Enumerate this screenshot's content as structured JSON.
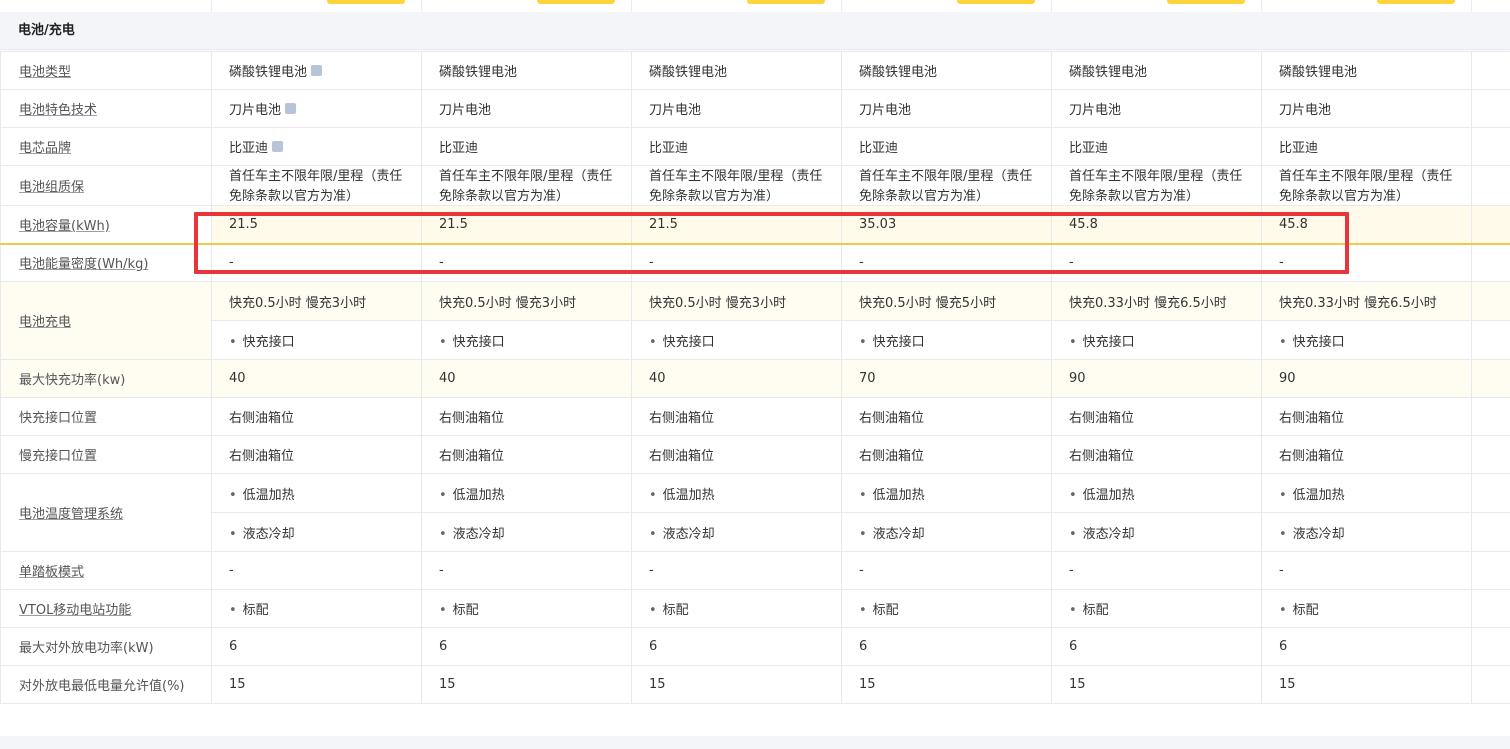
{
  "section_title": "电池/充电",
  "rows": {
    "battery_type": {
      "label": "电池类型",
      "values": [
        "磷酸铁锂电池",
        "磷酸铁锂电池",
        "磷酸铁锂电池",
        "磷酸铁锂电池",
        "磷酸铁锂电池",
        "磷酸铁锂电池"
      ]
    },
    "battery_tech": {
      "label": "电池特色技术",
      "values": [
        "刀片电池",
        "刀片电池",
        "刀片电池",
        "刀片电池",
        "刀片电池",
        "刀片电池"
      ]
    },
    "cell_brand": {
      "label": "电芯品牌",
      "values": [
        "比亚迪",
        "比亚迪",
        "比亚迪",
        "比亚迪",
        "比亚迪",
        "比亚迪"
      ]
    },
    "warranty": {
      "label": "电池组质保",
      "values": [
        "首任车主不限年限/里程（责任免除条款以官方为准）",
        "首任车主不限年限/里程（责任免除条款以官方为准）",
        "首任车主不限年限/里程（责任免除条款以官方为准）",
        "首任车主不限年限/里程（责任免除条款以官方为准）",
        "首任车主不限年限/里程（责任免除条款以官方为准）",
        "首任车主不限年限/里程（责任免除条款以官方为准）"
      ]
    },
    "capacity": {
      "label": "电池容量(kWh)",
      "values": [
        "21.5",
        "21.5",
        "21.5",
        "35.03",
        "45.8",
        "45.8"
      ]
    },
    "energy_density": {
      "label": "电池能量密度(Wh/kg)",
      "values": [
        "-",
        "-",
        "-",
        "-",
        "-",
        "-"
      ]
    },
    "charging": {
      "label": "电池充电",
      "times": [
        "快充0.5小时 慢充3小时",
        "快充0.5小时 慢充3小时",
        "快充0.5小时 慢充3小时",
        "快充0.5小时 慢充5小时",
        "快充0.33小时 慢充6.5小时",
        "快充0.33小时 慢充6.5小时"
      ],
      "port": "快充接口"
    },
    "max_fast_power": {
      "label": "最大快充功率(kw)",
      "values": [
        "40",
        "40",
        "40",
        "70",
        "90",
        "90"
      ]
    },
    "fast_port_pos": {
      "label": "快充接口位置",
      "values": [
        "右侧油箱位",
        "右侧油箱位",
        "右侧油箱位",
        "右侧油箱位",
        "右侧油箱位",
        "右侧油箱位"
      ]
    },
    "slow_port_pos": {
      "label": "慢充接口位置",
      "values": [
        "右侧油箱位",
        "右侧油箱位",
        "右侧油箱位",
        "右侧油箱位",
        "右侧油箱位",
        "右侧油箱位"
      ]
    },
    "thermal": {
      "label": "电池温度管理系统",
      "item1": "低温加热",
      "item2": "液态冷却"
    },
    "one_pedal": {
      "label": "单踏板模式",
      "values": [
        "-",
        "-",
        "-",
        "-",
        "-",
        "-"
      ]
    },
    "vtol": {
      "label": "VTOL移动电站功能",
      "value": "标配"
    },
    "max_discharge": {
      "label": "最大对外放电功率(kW)",
      "values": [
        "6",
        "6",
        "6",
        "6",
        "6",
        "6"
      ]
    },
    "min_soc": {
      "label": "对外放电最低电量允许值(%)",
      "values": [
        "15",
        "15",
        "15",
        "15",
        "15",
        "15"
      ]
    }
  }
}
